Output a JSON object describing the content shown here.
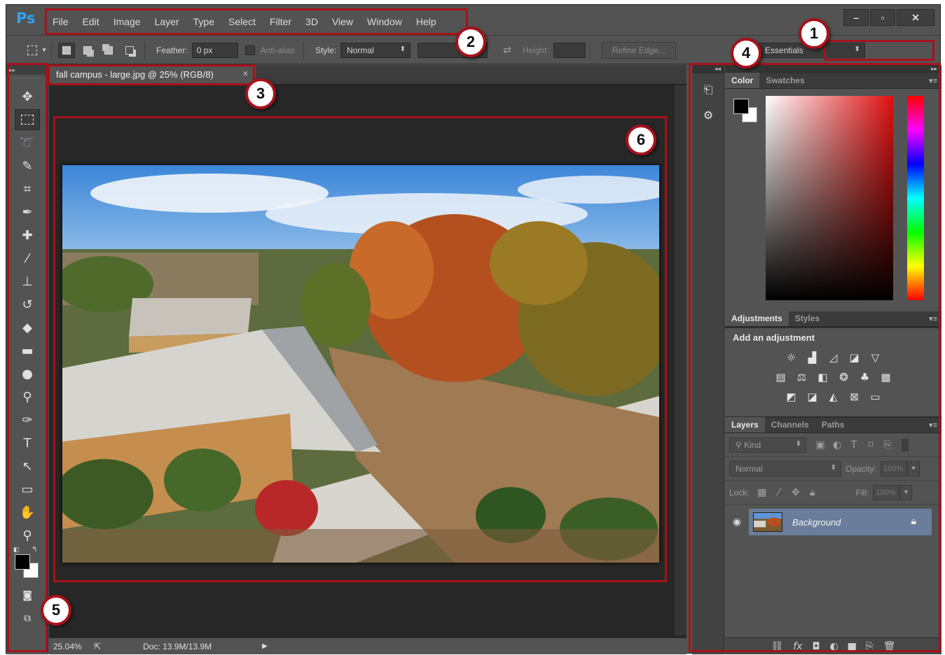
{
  "app": {
    "logo": "Ps"
  },
  "menu": [
    "File",
    "Edit",
    "Image",
    "Layer",
    "Type",
    "Select",
    "Filter",
    "3D",
    "View",
    "Window",
    "Help"
  ],
  "window_controls": {
    "minimize": "–",
    "maximize": "▫",
    "close": "✕"
  },
  "options": {
    "feather_label": "Feather:",
    "feather_value": "0 px",
    "antialias_label": "Anti-alias",
    "style_label": "Style:",
    "style_value": "Normal",
    "height_label": "Height:",
    "refine_edge": "Refine Edge...",
    "workspace": "Essentials"
  },
  "document": {
    "tab_title": "fall campus - large.jpg @ 25% (RGB/8)",
    "zoom": "25.04%",
    "doc_size": "Doc: 13.9M/13.9M"
  },
  "panels": {
    "color_tabs": [
      "Color",
      "Swatches"
    ],
    "adjustment_tabs": [
      "Adjustments",
      "Styles"
    ],
    "adjustments_title": "Add an adjustment",
    "layers_tabs": [
      "Layers",
      "Channels",
      "Paths"
    ],
    "kind_label": "Kind",
    "blend_mode": "Normal",
    "opacity_label": "Opacity:",
    "opacity_value": "100%",
    "lock_label": "Lock:",
    "fill_label": "Fill:",
    "fill_value": "100%",
    "layer_name": "Background"
  },
  "annotations": [
    "1",
    "2",
    "3",
    "4",
    "5",
    "6"
  ],
  "colors": {
    "highlight": "#a8111a",
    "ps_blue": "#2fa3f5",
    "layer_selected": "#6a7d9a"
  }
}
